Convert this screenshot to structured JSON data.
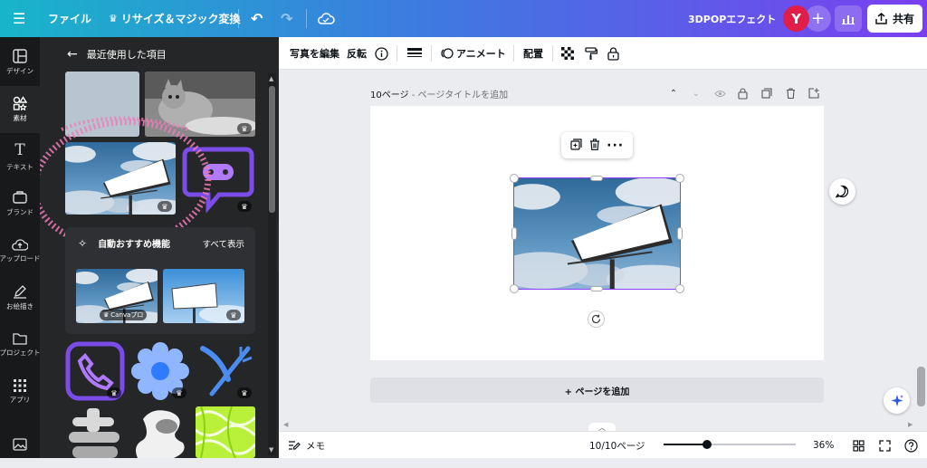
{
  "topbar": {
    "menu_icon": "hamburger-icon",
    "file_label": "ファイル",
    "resize_label": "リサイズ＆マジック変換",
    "design_title": "3DPOPエフェクト",
    "avatar_letter": "Y",
    "share_label": "共有",
    "colors": {
      "gradient_start": "#18b5c9",
      "gradient_end": "#7a3ff0",
      "avatar": "#e01e48"
    }
  },
  "rail": {
    "items": [
      {
        "label": "デザイン",
        "icon": "layout-icon"
      },
      {
        "label": "素材",
        "icon": "elements-icon"
      },
      {
        "label": "テキスト",
        "icon": "text-icon"
      },
      {
        "label": "ブランド",
        "icon": "brand-icon"
      },
      {
        "label": "アップロード",
        "icon": "upload-icon"
      },
      {
        "label": "お絵描き",
        "icon": "draw-icon"
      },
      {
        "label": "プロジェクト",
        "icon": "folder-icon"
      },
      {
        "label": "アプリ",
        "icon": "apps-icon"
      }
    ]
  },
  "panel": {
    "title": "最近使用した項目",
    "recommend": {
      "title": "自動おすすめ機能",
      "see_all": "すべて表示",
      "canva_pro_badge": "Canvaプロ"
    }
  },
  "toolbar": {
    "edit_photo": "写真を編集",
    "flip": "反転",
    "animate": "アニメート",
    "position": "配置"
  },
  "canvas": {
    "page_number": "10ページ",
    "page_title_placeholder": "ページタイトルを追加",
    "add_page": "+ ページを追加"
  },
  "status": {
    "notes": "メモ",
    "page_count": "10/10ページ",
    "zoom": "36%",
    "zoom_fraction": 0.33
  }
}
